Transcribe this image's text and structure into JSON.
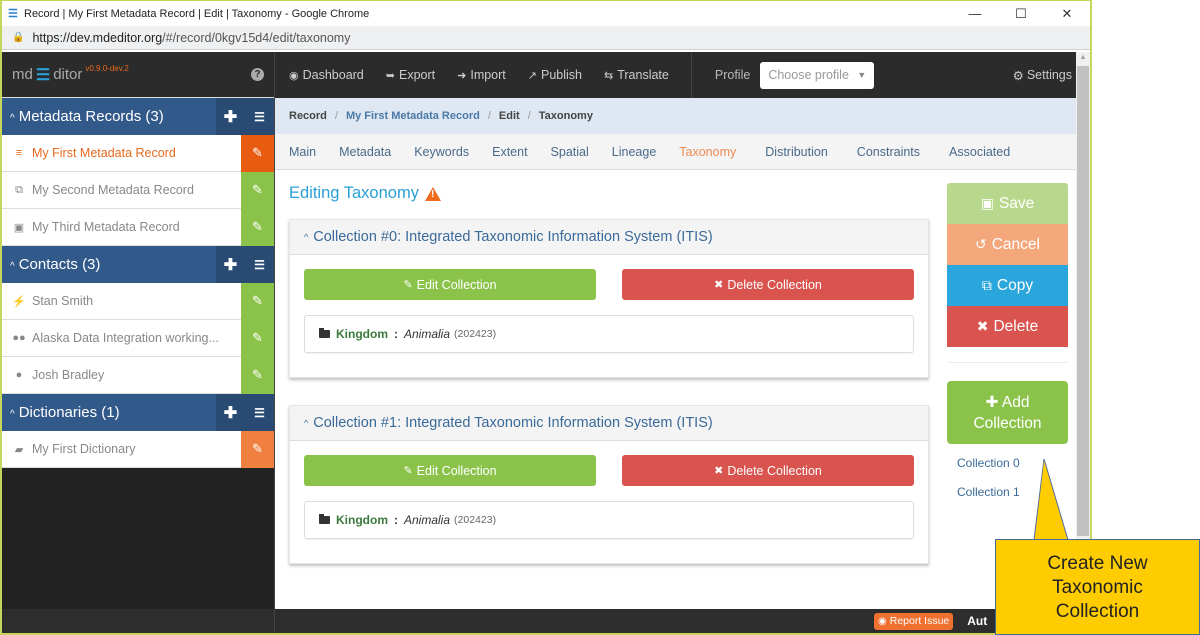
{
  "browser": {
    "window_title": "Record | My First Metadata Record | Edit | Taxonomy - Google Chrome",
    "url_host": "https://dev.mdeditor.org",
    "url_path": "/#/record/0kgv15d4/edit/taxonomy",
    "controls": {
      "minimize": "—",
      "maximize": "☐",
      "close": "✕"
    }
  },
  "brand": {
    "prefix": "md",
    "logo_glyph": "☰",
    "suffix": "ditor",
    "version": "v0.9.0-dev.2"
  },
  "sidebar": {
    "sections": [
      {
        "label": "Metadata Records (3)",
        "items": [
          {
            "icon": "database-icon",
            "glyph": "≡",
            "label": "My First Metadata Record",
            "active": true
          },
          {
            "icon": "clone-icon",
            "glyph": "⧉",
            "label": "My Second Metadata Record",
            "active": false
          },
          {
            "icon": "image-icon",
            "glyph": "▣",
            "label": "My Third Metadata Record",
            "active": false
          }
        ]
      },
      {
        "label": "Contacts (3)",
        "items": [
          {
            "icon": "person-running-icon",
            "glyph": "🏃",
            "label": "Stan Smith"
          },
          {
            "icon": "users-icon",
            "glyph": "👥",
            "label": "Alaska Data Integration working..."
          },
          {
            "icon": "user-icon",
            "glyph": "👤",
            "label": "Josh Bradley"
          }
        ]
      },
      {
        "label": "Dictionaries (1)",
        "items": [
          {
            "icon": "book-icon",
            "glyph": "▰",
            "label": "My First Dictionary"
          }
        ]
      }
    ],
    "add_glyph": "✚",
    "list_glyph": "☰",
    "edit_glyph": "✎",
    "chevron_glyph": "^"
  },
  "topnav": {
    "items": [
      {
        "glyph": "◉",
        "label": "Dashboard"
      },
      {
        "glyph": "➥",
        "label": "Export"
      },
      {
        "glyph": "➜",
        "label": "Import"
      },
      {
        "glyph": "↗",
        "label": "Publish"
      },
      {
        "glyph": "⇆",
        "label": "Translate"
      }
    ],
    "profile_label": "Profile",
    "profile_placeholder": "Choose profile",
    "profile_caret": "▼",
    "settings_glyph": "⚙",
    "settings_label": "Settings"
  },
  "breadcrumb": {
    "items": [
      "Record",
      "My First Metadata Record",
      "Edit",
      "Taxonomy"
    ],
    "separator": "/"
  },
  "tabs": [
    "Main",
    "Metadata",
    "Keywords",
    "Extent",
    "Spatial",
    "Lineage",
    "Taxonomy",
    "Distribution",
    "Constraints",
    "Associated"
  ],
  "active_tab": "Taxonomy",
  "page": {
    "title": "Editing Taxonomy",
    "collections": [
      {
        "title": "Collection #0: Integrated Taxonomic Information System (ITIS)",
        "edit_label": "Edit Collection",
        "delete_label": "Delete Collection",
        "taxon": {
          "rank": "Kingdom",
          "separator": ":",
          "name": "Animalia",
          "id": "(202423)"
        }
      },
      {
        "title": "Collection #1: Integrated Taxonomic Information System (ITIS)",
        "edit_label": "Edit Collection",
        "delete_label": "Delete Collection",
        "taxon": {
          "rank": "Kingdom",
          "separator": ":",
          "name": "Animalia",
          "id": "(202423)"
        }
      }
    ],
    "edit_glyph": "✎",
    "delete_glyph": "✖"
  },
  "actions": {
    "save": {
      "glyph": "💾",
      "label": "Save"
    },
    "cancel": {
      "glyph": "↺",
      "label": "Cancel"
    },
    "copy": {
      "glyph": "⧉",
      "label": "Copy"
    },
    "delete": {
      "glyph": "✖",
      "label": "Delete"
    },
    "add_collection": {
      "glyph": "✚",
      "line1": "Add",
      "line2": "Collection"
    },
    "links": [
      "Collection 0",
      "Collection 1"
    ]
  },
  "footer": {
    "report_glyph": "◉",
    "report_label": "Report Issue",
    "auto_label": "Aut"
  },
  "callout": {
    "lines": [
      "Create New",
      "Taxonomic",
      "Collection"
    ]
  },
  "colors": {
    "accent_blue": "#2a9fd6",
    "section_blue": "#31598a",
    "active_orange": "#e8681e",
    "edit_green": "#8bc34a",
    "delete_red": "#d9534f",
    "callout_yellow": "#ffcc00"
  }
}
